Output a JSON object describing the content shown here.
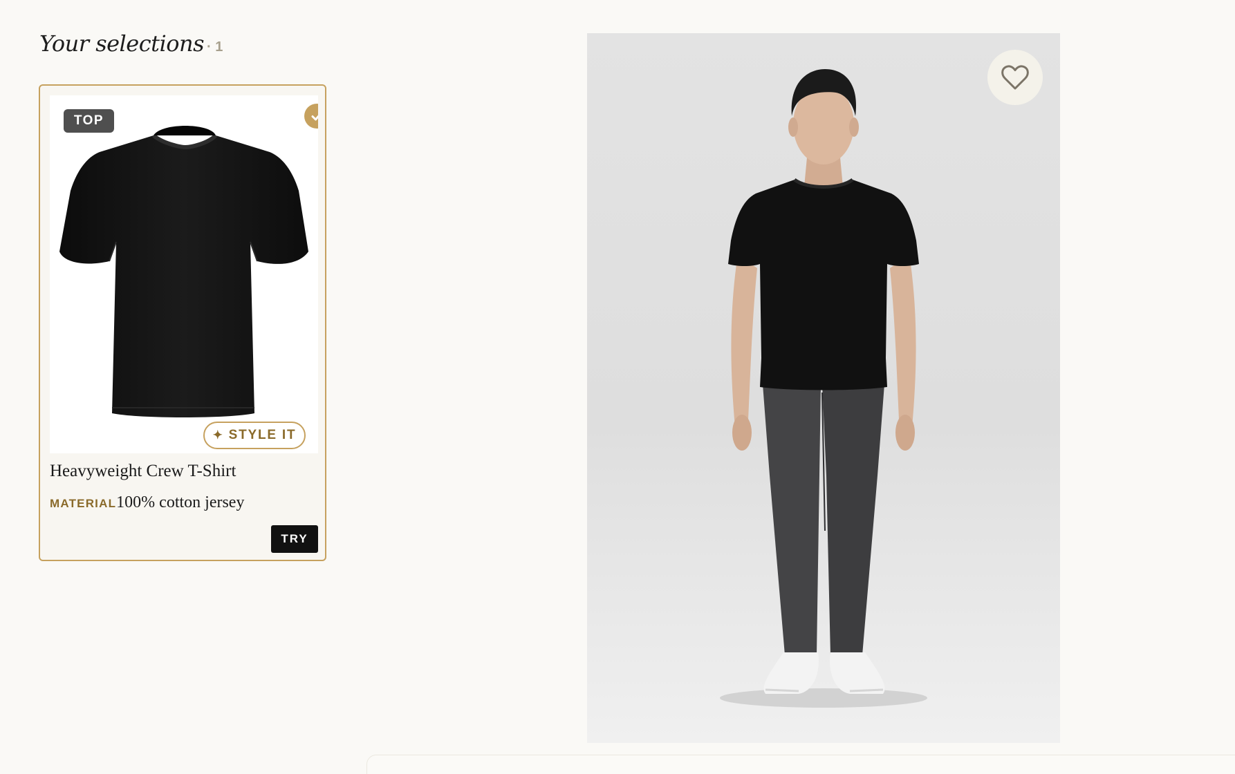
{
  "selections": {
    "title": "Your selections",
    "count_text": "· 1"
  },
  "card": {
    "category_badge": "TOP",
    "selected": true,
    "style_button_label": "STYLE IT",
    "style_button_icon": "sparkle-icon",
    "product_name": "Heavyweight Crew T-Shirt",
    "material_label": "MATERIAL",
    "material_value": "100% cotton jersey",
    "try_button_label": "TRY",
    "image": "black-tshirt-product-photo"
  },
  "preview": {
    "image": "model-wearing-black-tshirt-and-charcoal-jeans",
    "favorite_icon": "heart-icon",
    "favorited": false
  },
  "colors": {
    "accent_gold": "#c6a15e",
    "background": "#faf9f6",
    "badge_gray": "#4f4f4f",
    "button_black": "#111111"
  }
}
